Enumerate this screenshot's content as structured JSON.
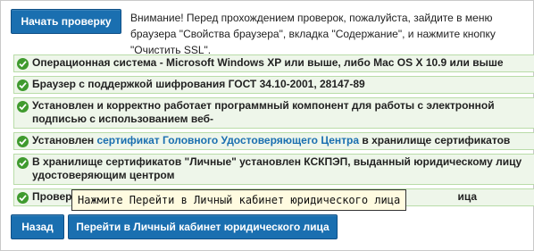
{
  "toolbar": {
    "start_check_label": "Начать проверку"
  },
  "warning": {
    "text": "Внимание! Перед прохождением проверок, пожалуйста, зайдите в меню браузера \"Свойства браузера\", вкладка \"Содержание\", и нажмите кнопку \"Очистить SSL\"."
  },
  "checks": [
    {
      "text": "Операционная система - Microsoft Windows XP или выше, либо Mac OS X 10.9 или выше"
    },
    {
      "text": "Браузер с поддержкой шифрования ГОСТ 34.10-2001, 28147-89"
    },
    {
      "text": "Установлен и корректно работает программный компонент для работы с электронной подписью с использованием веб-\nбраузера."
    },
    {
      "prefix": "Установлен ",
      "link": "сертификат Головного Удостоверяющего Центра",
      "suffix": " в хранилище сертификатов «Доверенные корневые центры»"
    },
    {
      "text": "В хранилище сертификатов \"Личные\" установлен КСКПЭП, выданный юридическому лицу удостоверяющим центром\nсоздана электронная подпись с использованием КСКПЭП юридического лица."
    },
    {
      "prefix": "Провер",
      "suffix": "ица"
    }
  ],
  "tooltip": {
    "text": "Нажмите Перейти в Личный кабинет юридического лица"
  },
  "footer": {
    "back_label": "Назад",
    "go_label": "Перейти в Личный кабинет юридического лица"
  }
}
